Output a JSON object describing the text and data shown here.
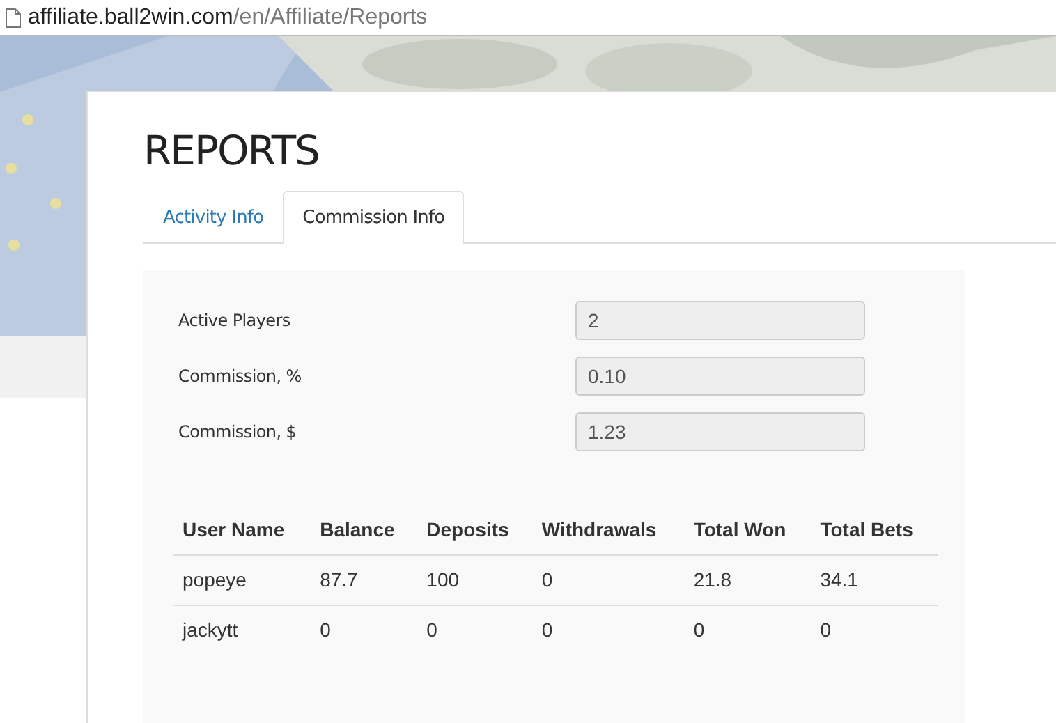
{
  "address_bar": {
    "domain": "affiliate.ball2win.com",
    "path": "/en/Affiliate/Reports"
  },
  "page": {
    "title": "REPORTS"
  },
  "tabs": [
    {
      "label": "Activity Info",
      "selected": false
    },
    {
      "label": "Commission Info",
      "selected": true
    }
  ],
  "fields": [
    {
      "label": "Active Players",
      "value": "2"
    },
    {
      "label": "Commission, %",
      "value": "0.10"
    },
    {
      "label": "Commission, $",
      "value": "1.23"
    }
  ],
  "table": {
    "columns": [
      "User Name",
      "Balance",
      "Deposits",
      "Withdrawals",
      "Total Won",
      "Total Bets"
    ],
    "rows": [
      [
        "popeye",
        "87.7",
        "100",
        "0",
        "21.8",
        "34.1"
      ],
      [
        "jackytt",
        "0",
        "0",
        "0",
        "0",
        "0"
      ]
    ]
  }
}
